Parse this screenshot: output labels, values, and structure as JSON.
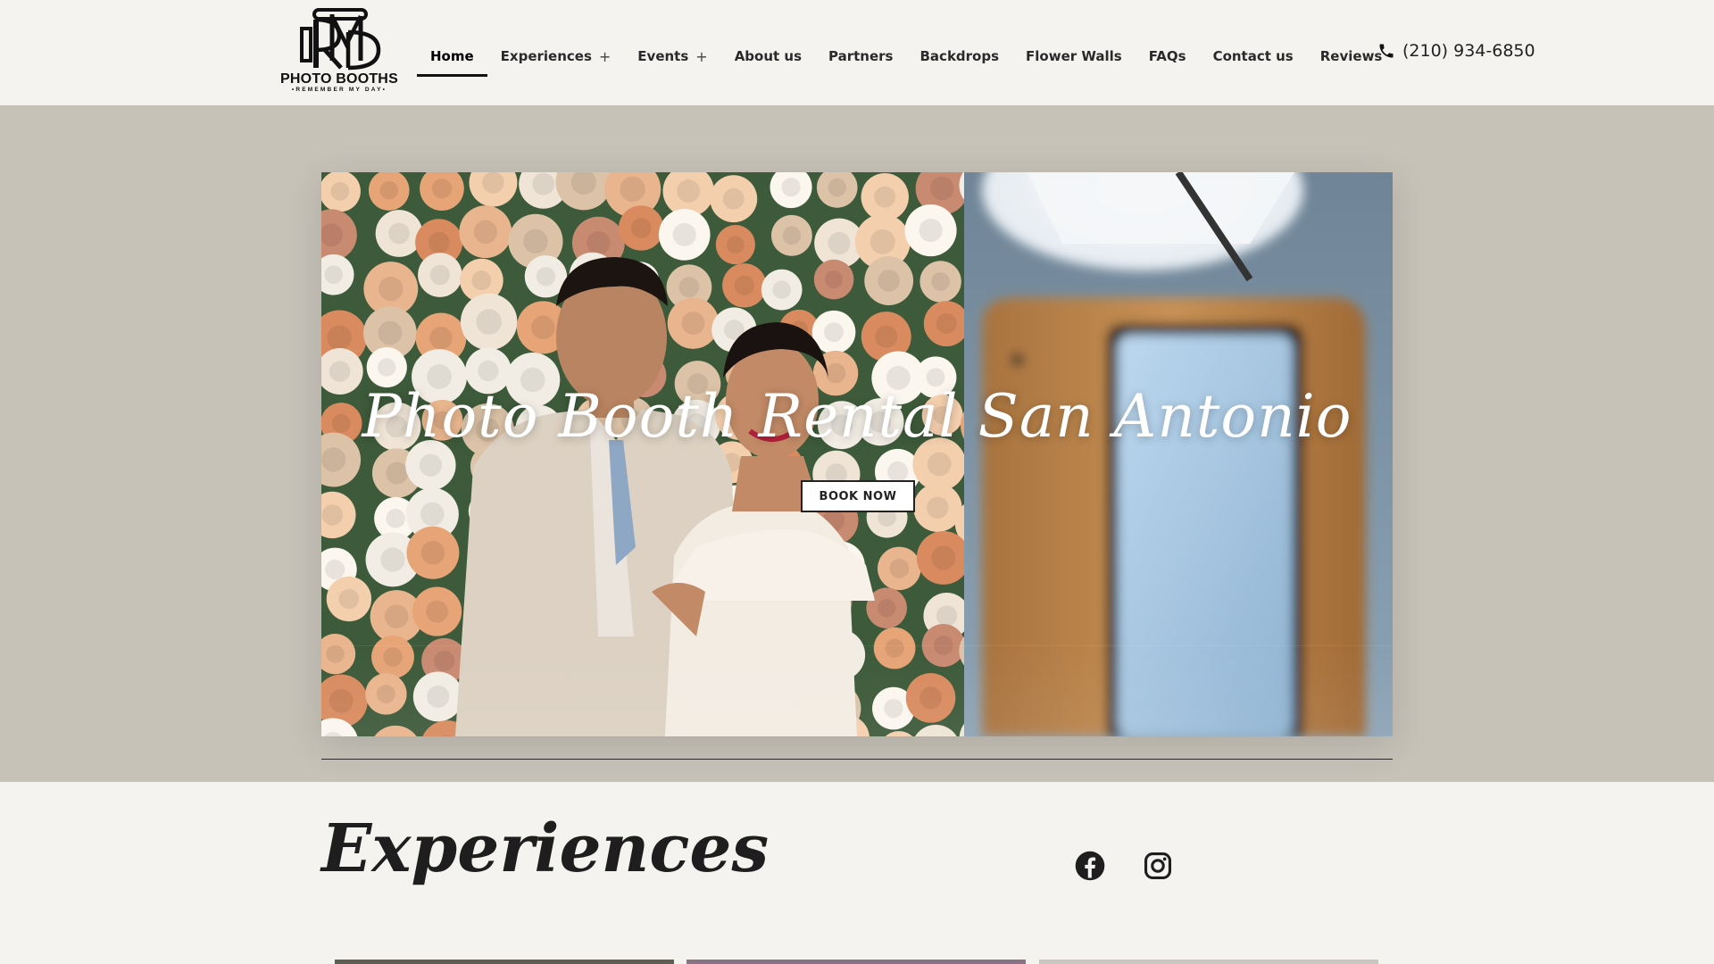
{
  "brand": {
    "logo_title": "PHOTO BOOTHS",
    "logo_tagline": "•REMEMBER MY DAY•"
  },
  "nav": {
    "items": [
      {
        "label": "Home",
        "active": true,
        "has_submenu": false
      },
      {
        "label": "Experiences",
        "active": false,
        "has_submenu": true
      },
      {
        "label": "Events",
        "active": false,
        "has_submenu": true
      },
      {
        "label": "About us",
        "active": false,
        "has_submenu": false
      },
      {
        "label": "Partners",
        "active": false,
        "has_submenu": false
      },
      {
        "label": "Backdrops",
        "active": false,
        "has_submenu": false
      },
      {
        "label": "Flower Walls",
        "active": false,
        "has_submenu": false
      },
      {
        "label": "FAQs",
        "active": false,
        "has_submenu": false
      },
      {
        "label": "Contact us",
        "active": false,
        "has_submenu": false
      },
      {
        "label": "Reviews",
        "active": false,
        "has_submenu": false
      }
    ],
    "submenu_symbol": "+"
  },
  "phone": {
    "icon": "phone-icon",
    "number": "(210) 934-6850"
  },
  "hero": {
    "title": "Photo Booth Rental San Antonio",
    "cta_label": "BOOK NOW"
  },
  "experiences": {
    "heading": "Experiences"
  },
  "social": [
    {
      "icon": "facebook-icon"
    },
    {
      "icon": "instagram-icon"
    }
  ],
  "colors": {
    "page_bg": "#f4f3ef",
    "hero_band": "#c6c2b8",
    "text_dark": "#1e1e1e",
    "accent": "#111111"
  }
}
